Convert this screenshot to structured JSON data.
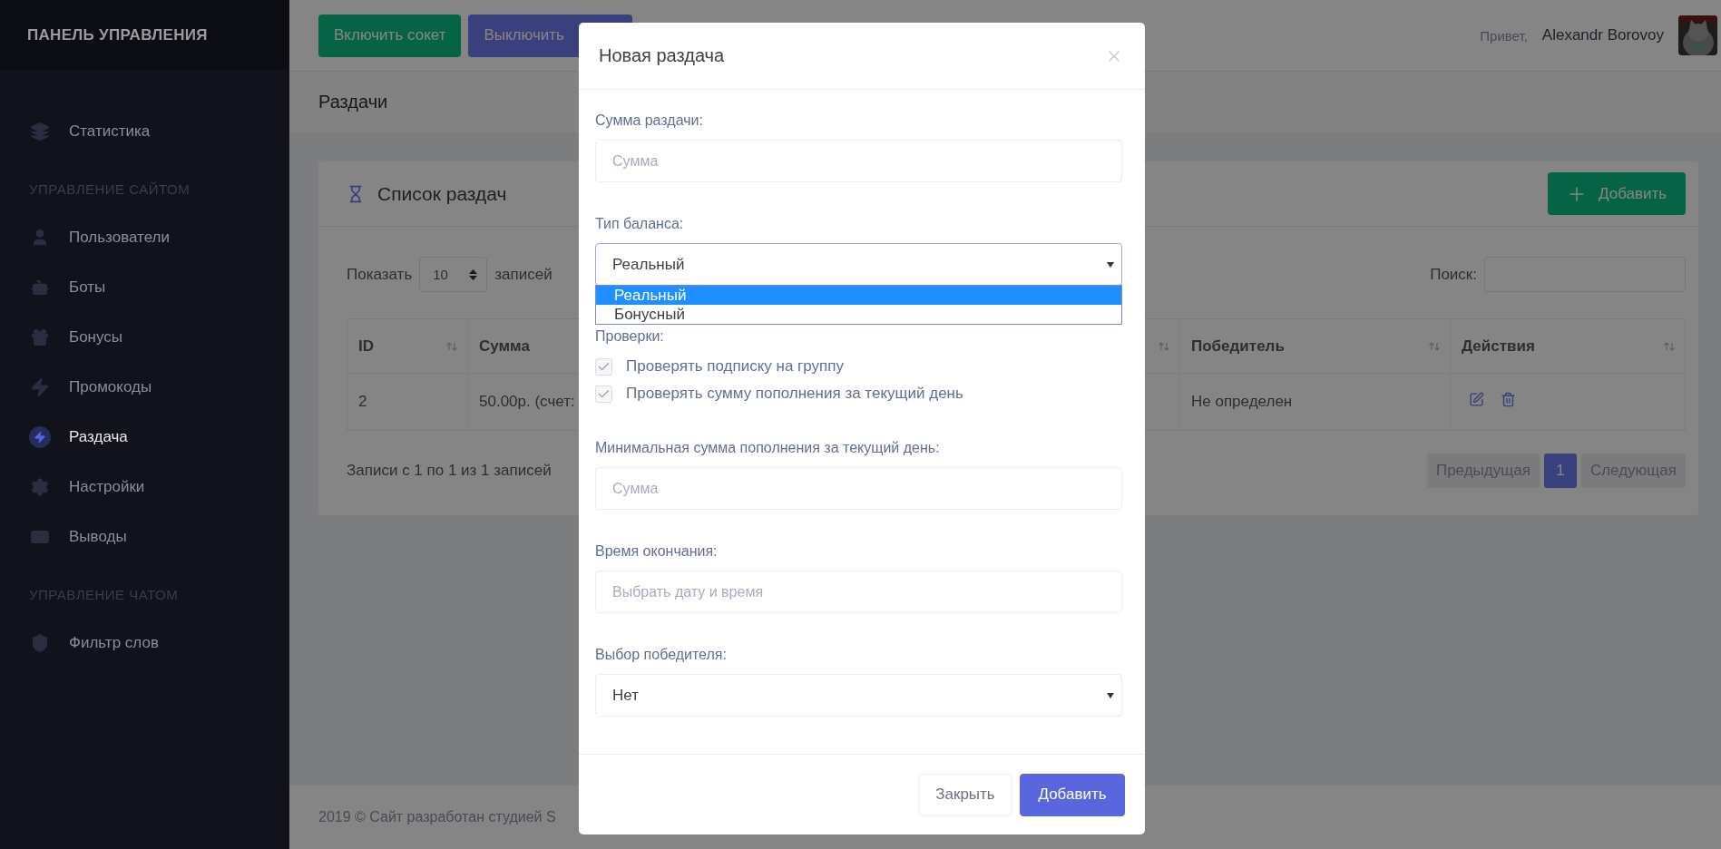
{
  "sidebar": {
    "title": "ПАНЕЛЬ УПРАВЛЕНИЯ",
    "items": [
      {
        "kind": "item",
        "label": "Статистика",
        "selected": false
      },
      {
        "kind": "section",
        "label": "УПРАВЛЕНИЕ САЙТОМ"
      },
      {
        "kind": "item",
        "label": "Пользователи",
        "selected": false
      },
      {
        "kind": "item",
        "label": "Боты",
        "selected": false
      },
      {
        "kind": "item",
        "label": "Бонусы",
        "selected": false
      },
      {
        "kind": "item",
        "label": "Промокоды",
        "selected": false
      },
      {
        "kind": "item",
        "label": "Раздача",
        "selected": true
      },
      {
        "kind": "item",
        "label": "Настройки",
        "selected": false
      },
      {
        "kind": "item",
        "label": "Выводы",
        "selected": false
      },
      {
        "kind": "section",
        "label": "УПРАВЛЕНИЕ ЧАТОМ"
      },
      {
        "kind": "item",
        "label": "Фильтр слов",
        "selected": false
      }
    ]
  },
  "topbar": {
    "buttons": [
      {
        "label": "Включить сокет",
        "kind": "success"
      },
      {
        "label": "Выключить",
        "kind": "primary"
      }
    ],
    "greeting": "Привет,",
    "user": "Alexandr Borovoy"
  },
  "page_title": "Раздачи",
  "card": {
    "title": "Список раздач",
    "add_button": "Добавить",
    "length": {
      "before": "Показать",
      "value": "10",
      "after": "записей"
    },
    "search_label": "Поиск:",
    "table": {
      "columns": [
        {
          "label": "ID"
        },
        {
          "label": "Сумма"
        },
        {
          "label": "Победитель"
        },
        {
          "label": "Действия"
        }
      ],
      "rows": [
        {
          "cells": [
            "2",
            "50.00р. (счет:",
            "Не определен"
          ]
        }
      ]
    },
    "info": "Записи с 1 по 1 из 1 записей",
    "pagination": [
      {
        "label": "Предыдущая",
        "selected": false,
        "disabled": true
      },
      {
        "label": "1",
        "selected": true,
        "disabled": false
      },
      {
        "label": "Следующая",
        "selected": false,
        "disabled": true
      }
    ]
  },
  "footer": "2019 © Сайт разработан студией S",
  "modal": {
    "title": "Новая раздача",
    "fields": [
      {
        "kind": "input",
        "label": "Сумма раздачи:",
        "placeholder": "Сумма"
      },
      {
        "kind": "select",
        "label": "Тип баланса:",
        "value": "Реальный",
        "expanded": true,
        "options": [
          {
            "label": "Реальный",
            "selected": true
          },
          {
            "label": "Бонусный",
            "selected": false
          }
        ]
      },
      {
        "kind": "checks",
        "label": "Проверки:",
        "items": [
          {
            "label": "Проверять подписку на группу",
            "checked": true
          },
          {
            "label": "Проверять сумму пополнения за текущий день",
            "checked": true
          }
        ]
      },
      {
        "kind": "input",
        "label": "Минимальная сумма пополнения за текущий день:",
        "placeholder": "Сумма"
      },
      {
        "kind": "input",
        "label": "Время окончания:",
        "placeholder": "Выбрать дату и время"
      },
      {
        "kind": "select",
        "label": "Выбор победителя:",
        "value": "Нет",
        "expanded": false
      }
    ],
    "buttons": [
      {
        "label": "Закрыть",
        "kind": "secondary"
      },
      {
        "label": "Добавить",
        "kind": "primary"
      }
    ]
  }
}
